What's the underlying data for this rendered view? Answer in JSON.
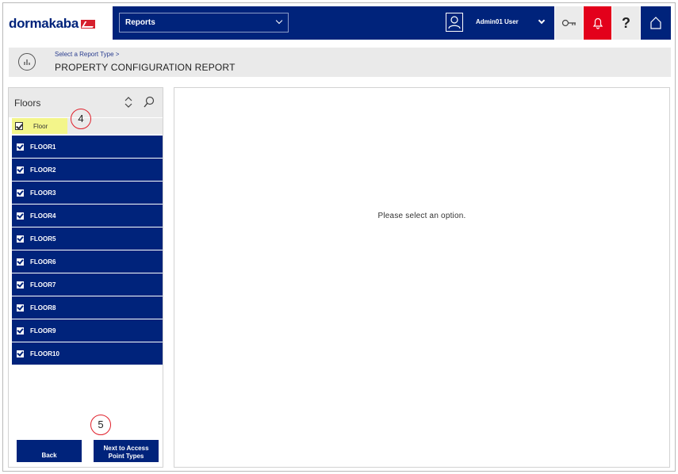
{
  "header": {
    "logo": "dormakaba",
    "report_select_value": "Reports",
    "user_name": "Admin01 User",
    "help_label": "?"
  },
  "breadcrumb": {
    "link": "Select a Report Type >",
    "title": "PROPERTY CONFIGURATION REPORT"
  },
  "left_panel": {
    "title": "Floors",
    "column_header": "Floor",
    "floors": [
      "FLOOR1",
      "FLOOR2",
      "FLOOR3",
      "FLOOR4",
      "FLOOR5",
      "FLOOR6",
      "FLOOR7",
      "FLOOR8",
      "FLOOR9",
      "FLOOR10"
    ],
    "back_label": "Back",
    "next_label_line1": "Next to Access",
    "next_label_line2": "Point Types"
  },
  "main": {
    "message": "Please select an option."
  },
  "callouts": {
    "step_4": "4",
    "step_5": "5"
  },
  "colors": {
    "brand_navy": "#00237b",
    "alert_red": "#e3001b",
    "highlight_yellow": "#f3f58a",
    "callout_red": "#e0202b"
  },
  "icons": [
    "user-icon",
    "chevron-down-icon",
    "key-icon",
    "bell-icon",
    "home-icon",
    "report-chart-icon",
    "sort-icon",
    "search-icon",
    "checkbox-icon"
  ]
}
